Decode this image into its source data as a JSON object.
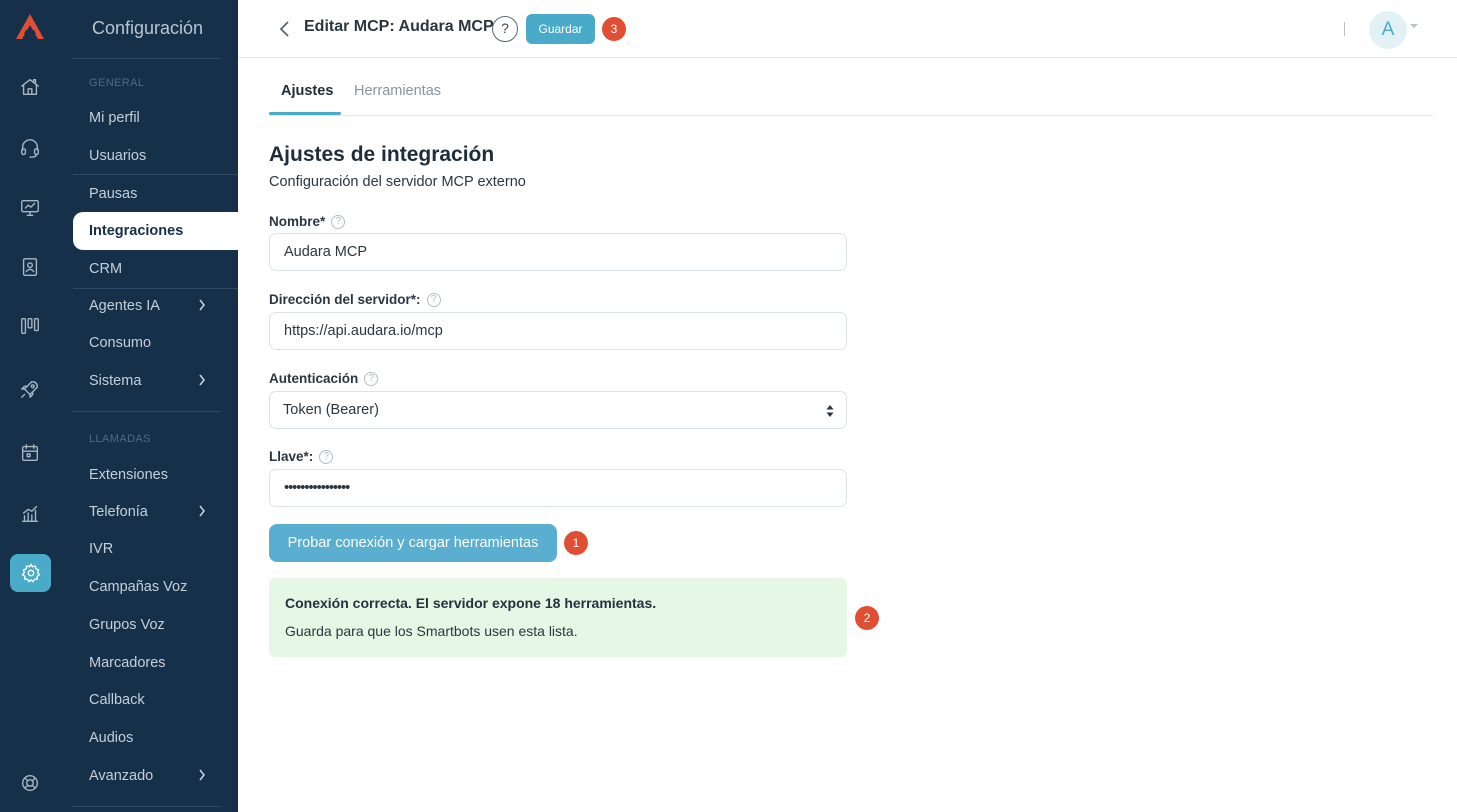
{
  "sidebar": {
    "title": "Configuración",
    "sections": {
      "general": "GENERAL",
      "calls": "LLAMADAS"
    },
    "items": {
      "profile": "Mi perfil",
      "users": "Usuarios",
      "pauses": "Pausas",
      "integrations": "Integraciones",
      "crm": "CRM",
      "ai_agents": "Agentes IA",
      "consumption": "Consumo",
      "system": "Sistema",
      "extensions": "Extensiones",
      "telephony": "Telefonía",
      "ivr": "IVR",
      "voice_campaigns": "Campañas Voz",
      "voice_groups": "Grupos Voz",
      "dialers": "Marcadores",
      "callback": "Callback",
      "audios": "Audios",
      "advanced": "Avanzado"
    },
    "active_item": "Integraciones"
  },
  "rail": {
    "icons": [
      "logo-icon",
      "home-icon",
      "headset-icon",
      "monitor-icon",
      "contacts-icon",
      "kanban-icon",
      "rocket-icon",
      "calendar-icon",
      "analytics-icon",
      "gear-icon",
      "lifebuoy-icon"
    ],
    "active": "gear-icon",
    "accent": "#4aabc9"
  },
  "header": {
    "title": "Editar MCP: Audara MCP",
    "help": "?",
    "save_label": "Guardar",
    "badge_3": "3",
    "avatar": "A"
  },
  "tabs": {
    "settings": "Ajustes",
    "tools": "Herramientas",
    "active": "Ajustes"
  },
  "form": {
    "heading": "Ajustes de integración",
    "subheading": "Configuración del servidor MCP externo",
    "help_glyph": "?",
    "name": {
      "label": "Nombre*",
      "value": "Audara MCP"
    },
    "server": {
      "label": "Dirección del servidor*:",
      "value": "https://api.audara.io/mcp"
    },
    "auth": {
      "label": "Autenticación",
      "value": "Token (Bearer)"
    },
    "key": {
      "label": "Llave*:",
      "value": "••••••••••••••••"
    },
    "test_button": "Probar conexión y cargar herramientas",
    "badge_1": "1"
  },
  "result": {
    "title": "Conexión correcta. El servidor expone 18 herramientas.",
    "message": "Guarda para que los Smartbots usen esta lista.",
    "badge_2": "2"
  },
  "colors": {
    "navy": "#16304a",
    "accent": "#4aabc9",
    "badge": "#e04e34",
    "success_bg": "#e7f7e5"
  }
}
